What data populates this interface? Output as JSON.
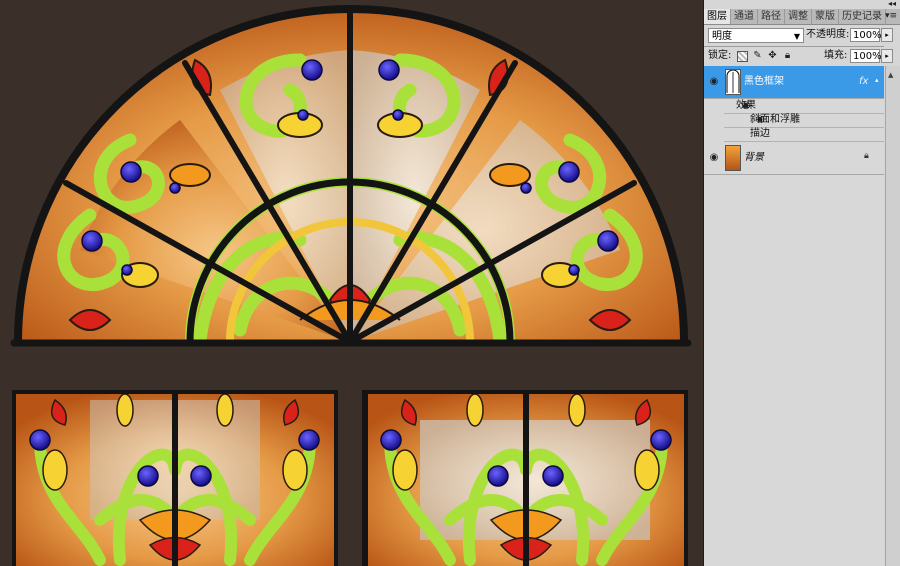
{
  "panel": {
    "collapse_glyph": "◂◂",
    "tabs": [
      "图层",
      "通道",
      "路径",
      "调整",
      "蒙版",
      "历史记录"
    ],
    "active_tab": 0,
    "menu_glyph": "▾≡",
    "blend_mode": "明度",
    "opacity_label": "不透明度:",
    "opacity_value": "100%",
    "lock_label": "锁定:",
    "fill_label": "填充:",
    "fill_value": "100%",
    "layers": [
      {
        "name": "黑色框架",
        "selected": true,
        "has_fx": true,
        "fx_label": "fx"
      },
      {
        "name": "背景",
        "selected": false,
        "locked": true
      }
    ],
    "effects": {
      "header": "效果",
      "items": [
        "斜面和浮雕",
        "描边"
      ]
    }
  },
  "colors": {
    "canvas_bg": "#3b2f29",
    "selection": "#3a9ae8",
    "glass_green": "#b3e63a",
    "glass_orange": "#e3842a",
    "jewel_blue": "#2a23c4",
    "lead_frame": "#141414"
  },
  "icons": {
    "eye": "eye-icon",
    "lock": "lock-icon",
    "move": "move-icon",
    "brush": "brush-icon",
    "transparency": "checker-icon"
  }
}
